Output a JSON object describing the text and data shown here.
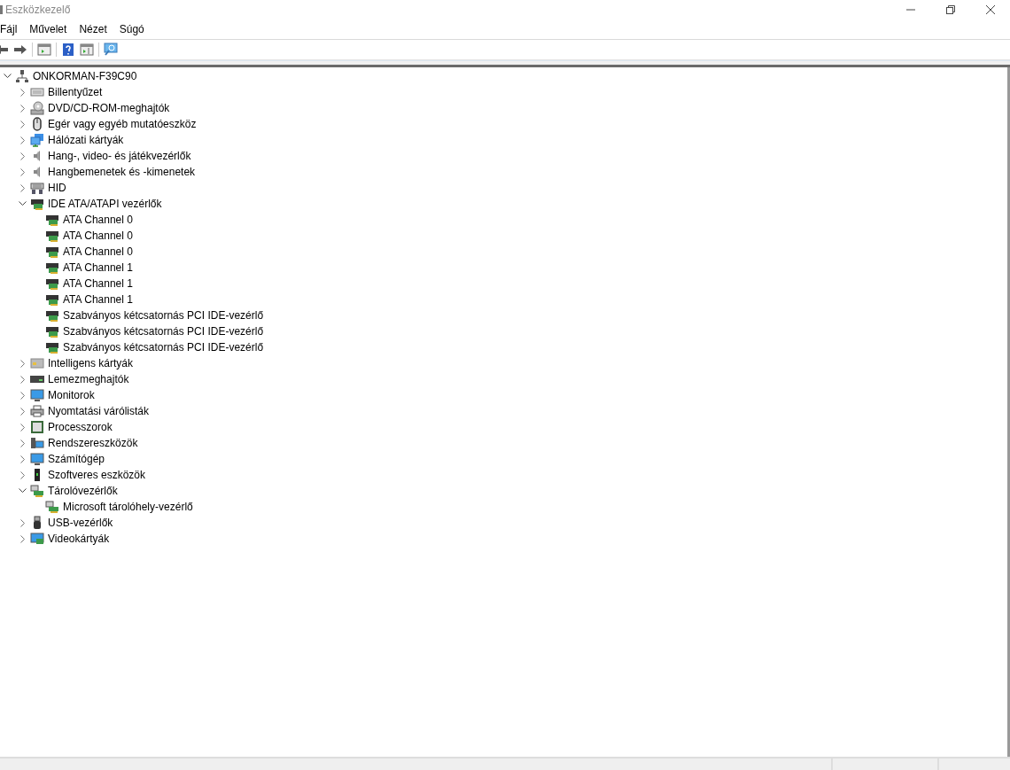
{
  "window": {
    "title": "Eszközkezelő"
  },
  "menu": [
    "Fájl",
    "Művelet",
    "Nézet",
    "Súgó"
  ],
  "toolbar": [
    {
      "kind": "back"
    },
    {
      "kind": "forward"
    },
    {
      "kind": "sep"
    },
    {
      "kind": "properties"
    },
    {
      "kind": "sep"
    },
    {
      "kind": "help"
    },
    {
      "kind": "pane"
    },
    {
      "kind": "sep"
    },
    {
      "kind": "scan"
    }
  ],
  "tree": {
    "label": "ONKORMAN-F39C90",
    "kind": "host",
    "expanded": true,
    "children": [
      {
        "label": "Billentyűzet",
        "kind": "keyboard",
        "expanded": false
      },
      {
        "label": "DVD/CD-ROM-meghajtók",
        "kind": "disc",
        "expanded": false
      },
      {
        "label": "Egér vagy egyéb mutatóeszköz",
        "kind": "mouse",
        "expanded": false
      },
      {
        "label": "Hálózati kártyák",
        "kind": "network",
        "expanded": false
      },
      {
        "label": "Hang-, video- és játékvezérlők",
        "kind": "speaker",
        "expanded": false
      },
      {
        "label": "Hangbemenetek és -kimenetek",
        "kind": "speaker",
        "expanded": false
      },
      {
        "label": "HID",
        "kind": "hid",
        "expanded": false
      },
      {
        "label": "IDE ATA/ATAPI vezérlők",
        "kind": "controller",
        "expanded": true,
        "children": [
          {
            "label": "ATA Channel 0",
            "kind": "controller"
          },
          {
            "label": "ATA Channel 0",
            "kind": "controller"
          },
          {
            "label": "ATA Channel 0",
            "kind": "controller"
          },
          {
            "label": "ATA Channel 1",
            "kind": "controller"
          },
          {
            "label": "ATA Channel 1",
            "kind": "controller"
          },
          {
            "label": "ATA Channel 1",
            "kind": "controller"
          },
          {
            "label": "Szabványos kétcsatornás PCI IDE-vezérlő",
            "kind": "controller"
          },
          {
            "label": "Szabványos kétcsatornás PCI IDE-vezérlő",
            "kind": "controller"
          },
          {
            "label": "Szabványos kétcsatornás PCI IDE-vezérlő",
            "kind": "controller"
          }
        ]
      },
      {
        "label": "Intelligens kártyák",
        "kind": "smartcard",
        "expanded": false
      },
      {
        "label": "Lemezmeghajtók",
        "kind": "disk",
        "expanded": false
      },
      {
        "label": "Monitorok",
        "kind": "monitor",
        "expanded": false
      },
      {
        "label": "Nyomtatási várólisták",
        "kind": "printer",
        "expanded": false
      },
      {
        "label": "Processzorok",
        "kind": "cpu",
        "expanded": false
      },
      {
        "label": "Rendszereszközök",
        "kind": "system",
        "expanded": false
      },
      {
        "label": "Számítógép",
        "kind": "monitor",
        "expanded": false
      },
      {
        "label": "Szoftveres eszközök",
        "kind": "software",
        "expanded": false
      },
      {
        "label": "Tárolóvezérlők",
        "kind": "storage",
        "expanded": true,
        "children": [
          {
            "label": "Microsoft tárolóhely-vezérlő",
            "kind": "storage"
          }
        ]
      },
      {
        "label": "USB-vezérlők",
        "kind": "usb",
        "expanded": false
      },
      {
        "label": "Videokártyák",
        "kind": "video",
        "expanded": false
      }
    ]
  }
}
